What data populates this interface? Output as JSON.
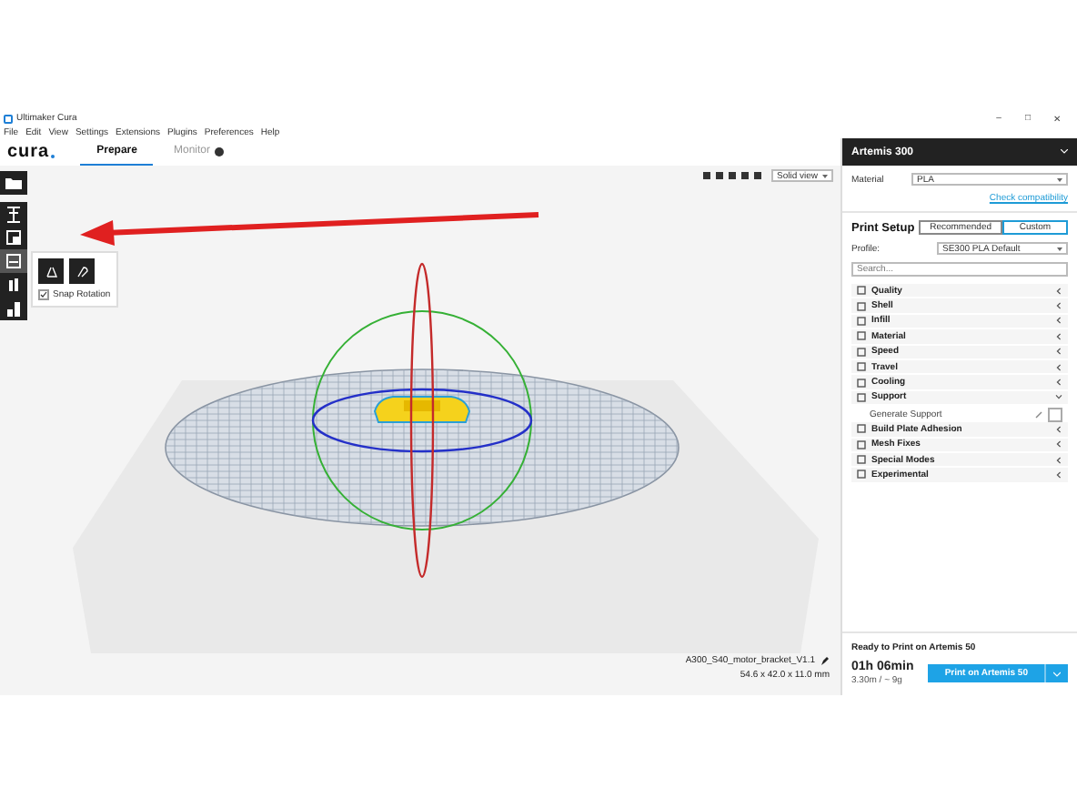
{
  "window": {
    "title": "Ultimaker Cura",
    "controls": [
      "–",
      "□",
      "✕"
    ]
  },
  "menu": [
    "File",
    "Edit",
    "View",
    "Settings",
    "Extensions",
    "Plugins",
    "Preferences",
    "Help"
  ],
  "header": {
    "logo": "cura",
    "tabs": [
      {
        "label": "Prepare",
        "selected": true
      },
      {
        "label": "Monitor",
        "selected": false
      }
    ]
  },
  "view_mode": "Solid view",
  "tools": [
    {
      "kind": "open",
      "selected": false
    },
    {
      "kind": "move",
      "selected": false
    },
    {
      "kind": "scale",
      "selected": false
    },
    {
      "kind": "rotate",
      "selected": true
    },
    {
      "kind": "mirror",
      "selected": false
    },
    {
      "kind": "support",
      "selected": false
    }
  ],
  "rotate_panel": {
    "snap_rotation": {
      "label": "Snap Rotation",
      "checked": true
    }
  },
  "printer": {
    "name": "Artemis 300"
  },
  "material": {
    "label": "Material",
    "value": "PLA",
    "link": "Check compatibility"
  },
  "print_setup": {
    "title": "Print Setup",
    "modes": [
      {
        "label": "Recommended",
        "selected": false
      },
      {
        "label": "Custom",
        "selected": true
      }
    ],
    "profile_label": "Profile:",
    "profile": "SE300 PLA Default",
    "search_placeholder": "Search...",
    "categories": [
      {
        "label": "Quality",
        "expanded": false
      },
      {
        "label": "Shell",
        "expanded": false
      },
      {
        "label": "Infill",
        "expanded": false
      },
      {
        "label": "Material",
        "expanded": false
      },
      {
        "label": "Speed",
        "expanded": false
      },
      {
        "label": "Travel",
        "expanded": false
      },
      {
        "label": "Cooling",
        "expanded": false
      },
      {
        "label": "Support",
        "expanded": true,
        "children": [
          {
            "label": "Generate Support",
            "checked": false
          }
        ]
      },
      {
        "label": "Build Plate Adhesion",
        "expanded": false
      },
      {
        "label": "Mesh Fixes",
        "expanded": false
      },
      {
        "label": "Special Modes",
        "expanded": false
      },
      {
        "label": "Experimental",
        "expanded": false
      }
    ]
  },
  "object": {
    "name": "A300_S40_motor_bracket_V1.1",
    "dimensions": "54.6 x 42.0 x 11.0 mm"
  },
  "output": {
    "status": "Ready to Print on Artemis 50",
    "time": "01h 06min",
    "usage": "3.30m / ~ 9g",
    "button": "Print on Artemis 50"
  }
}
